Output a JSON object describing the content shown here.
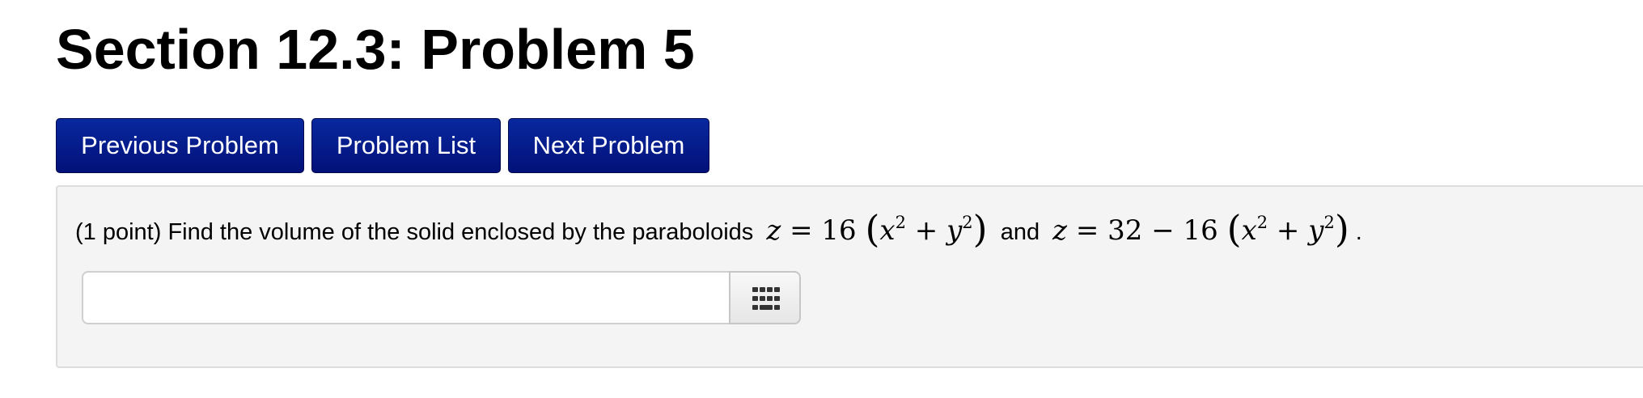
{
  "page": {
    "title": "Section 12.3: Problem 5"
  },
  "nav": {
    "previous_label": "Previous Problem",
    "list_label": "Problem List",
    "next_label": "Next Problem"
  },
  "problem": {
    "prefix": "(1 point) Find the volume of the solid enclosed by the paraboloids",
    "connector": "and",
    "suffix": ".",
    "equation1": "z = 16 (x² + y²)",
    "equation2": "z = 32 − 16 (x² + y²)"
  },
  "answer": {
    "value": "",
    "palette_icon": "keypad-grid-icon"
  },
  "colors": {
    "button_bg": "#031696",
    "panel_bg": "#f4f4f4",
    "panel_border": "#dddddd"
  }
}
